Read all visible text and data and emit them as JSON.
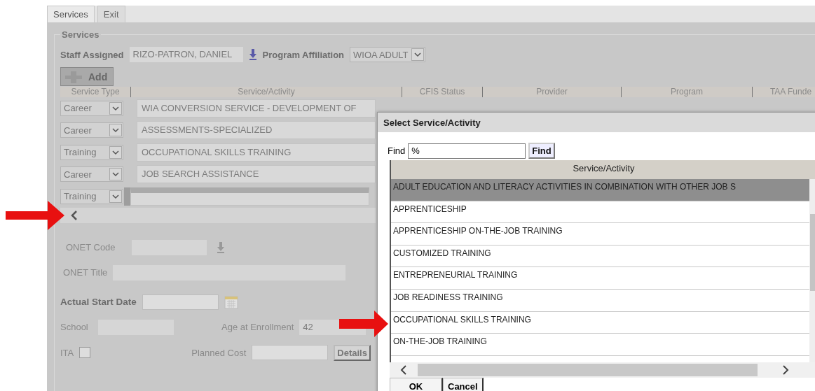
{
  "tabs": [
    {
      "label": "Services",
      "selected": true
    },
    {
      "label": "Exit",
      "selected": false
    }
  ],
  "section_title": "Services",
  "staff_assigned": {
    "label": "Staff Assigned",
    "value": "RIZO-PATRON, DANIEL"
  },
  "program_affiliation": {
    "label": "Program Affiliation",
    "value": "WIOA ADULT"
  },
  "add_button": "Add",
  "services_table": {
    "columns": [
      "Service Type",
      "Service/Activity",
      "CFIS Status",
      "Provider",
      "Program",
      "TAA Funde"
    ],
    "rows": [
      {
        "service_type": "Career",
        "service_activity": "WIA CONVERSION SERVICE - DEVELOPMENT OF",
        "selected": false
      },
      {
        "service_type": "Career",
        "service_activity": "ASSESSMENTS-SPECIALIZED",
        "selected": false
      },
      {
        "service_type": "Training",
        "service_activity": "OCCUPATIONAL SKILLS TRAINING",
        "selected": false
      },
      {
        "service_type": "Career",
        "service_activity": "JOB SEARCH ASSISTANCE",
        "selected": false
      },
      {
        "service_type": "Training",
        "selected": true
      }
    ]
  },
  "details": {
    "onet_code_label": "ONET Code",
    "onet_title_label": "ONET Title",
    "actual_start_date_label": "Actual Start Date",
    "school_label": "School",
    "age_at_enrollment": {
      "label": "Age at Enrollment",
      "value": "42"
    },
    "ita": {
      "label": "ITA",
      "checked": false
    },
    "planned_cost_label": "Planned Cost",
    "details_button": "Details"
  },
  "dialog": {
    "title": "Select Service/Activity",
    "find_label": "Find",
    "find_value": "%",
    "find_button": "Find",
    "column": "Service/Activity",
    "items": [
      {
        "label": "ADULT EDUCATION AND LITERACY ACTIVITIES IN COMBINATION WITH OTHER JOB S",
        "selected": true
      },
      {
        "label": "APPRENTICESHIP",
        "selected": false
      },
      {
        "label": "APPRENTICESHIP ON-THE-JOB TRAINING",
        "selected": false
      },
      {
        "label": "CUSTOMIZED TRAINING",
        "selected": false
      },
      {
        "label": "ENTREPRENEURIAL TRAINING",
        "selected": false
      },
      {
        "label": "JOB READINESS TRAINING",
        "selected": false
      },
      {
        "label": "OCCUPATIONAL SKILLS TRAINING",
        "selected": false
      },
      {
        "label": "ON-THE-JOB TRAINING",
        "selected": false
      }
    ],
    "buttons": [
      "OK",
      "Cancel"
    ]
  }
}
